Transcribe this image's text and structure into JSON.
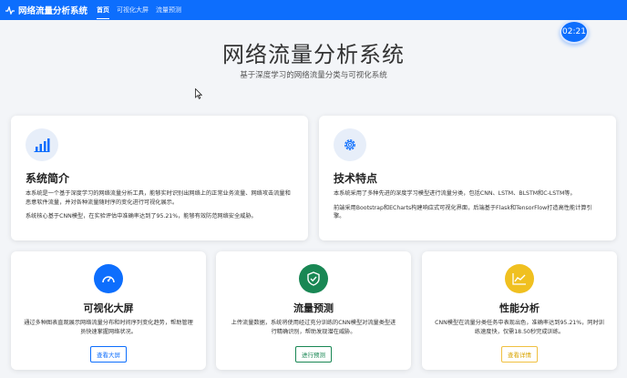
{
  "nav": {
    "brand": "网络流量分析系统",
    "links": [
      "首页",
      "可视化大屏",
      "流量预测"
    ],
    "active_index": 0
  },
  "clock": "02:21",
  "hero": {
    "title": "网络流量分析系统",
    "subtitle": "基于深度学习的网络流量分类与可视化系统"
  },
  "intro_card": {
    "icon": "bar-chart-icon",
    "title": "系统简介",
    "text1": "本系统是一个基于深度学习的网络流量分析工具，能够实时识别出网络上的正常业务流量、网络攻击流量和恶意软件流量，并对各种流量随时序的变化进行可视化展示。",
    "text2": "系统核心基于CNN模型，在实验评估中准确率达到了95.21%，能够有效防范网络安全威胁。"
  },
  "tech_card": {
    "icon": "gear-icon",
    "title": "技术特点",
    "text1": "本系统采用了多种先进的深度学习模型进行流量分类，包括CNN、LSTM、BLSTM和C-LSTM等。",
    "text2": "前端采用Bootstrap和ECharts构建响应式可视化界面，后端基于Flask和TensorFlow打造高性能计算引擎。"
  },
  "bottom_cards": [
    {
      "icon": "speedometer-icon",
      "title": "可视化大屏",
      "text": "通过多种图表直观展示网络流量分布和时间序列变化趋势，帮助管理员快速掌握网络状况。",
      "button": "查看大屏",
      "color": "#0d6efd"
    },
    {
      "icon": "shield-icon",
      "title": "流量预测",
      "text": "上传流量数据，系统将使用经过充分训练的CNN模型对流量类型进行精确识别，帮助发现潜在威胁。",
      "button": "进行预测",
      "color": "#198754"
    },
    {
      "icon": "line-chart-icon",
      "title": "性能分析",
      "text": "CNN模型在流量分类任务中表现出色，准确率达到95.21%，同时训练速度快，仅需18.50秒完成训练。",
      "button": "查看详情",
      "color": "#f0c040"
    }
  ]
}
